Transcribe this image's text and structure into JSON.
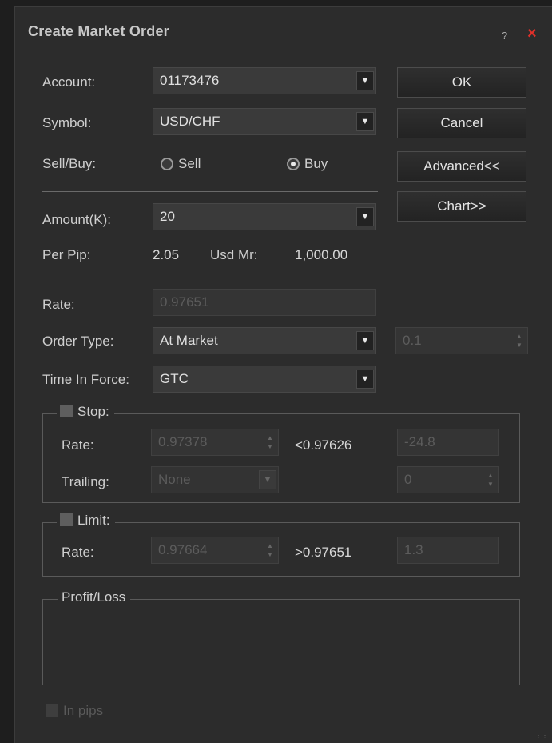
{
  "window": {
    "title": "Create Market Order",
    "help_label": "?",
    "close_label": "×"
  },
  "fields": {
    "account": {
      "label": "Account:",
      "value": "01173476"
    },
    "symbol": {
      "label": "Symbol:",
      "value": "USD/CHF"
    },
    "sellbuy": {
      "label": "Sell/Buy:",
      "sell": "Sell",
      "buy": "Buy",
      "selected": "Buy"
    },
    "amount": {
      "label": "Amount(K):",
      "value": "20"
    },
    "perpip": {
      "label": "Per Pip:",
      "value": "2.05"
    },
    "usdmr": {
      "label": "Usd Mr:",
      "value": "1,000.00"
    },
    "rate": {
      "label": "Rate:",
      "value": "0.97651"
    },
    "order_type": {
      "label": "Order Type:",
      "value": "At Market",
      "extra": "0.1"
    },
    "time_in_force": {
      "label": "Time In Force:",
      "value": "GTC"
    }
  },
  "buttons": {
    "ok": "OK",
    "cancel": "Cancel",
    "advanced": "Advanced<<",
    "chart": "Chart>>"
  },
  "stop": {
    "caption": "Stop:",
    "rate_label": "Rate:",
    "rate_value": "0.97378",
    "compare": "<0.97626",
    "pips": "-24.8",
    "trailing_label": "Trailing:",
    "trailing_value": "None",
    "trailing_num": "0"
  },
  "limit": {
    "caption": "Limit:",
    "rate_label": "Rate:",
    "rate_value": "0.97664",
    "compare": ">0.97651",
    "pips": "1.3"
  },
  "profit_loss": {
    "caption": "Profit/Loss"
  },
  "in_pips": {
    "label": "In pips"
  },
  "icons": {
    "dropdown": "chevron-down-icon",
    "spinner": "spinner-arrows-icon",
    "close": "close-icon"
  },
  "colors": {
    "background": "#2c2c2c",
    "close": "#e0302a",
    "text": "#d8d8d8"
  }
}
